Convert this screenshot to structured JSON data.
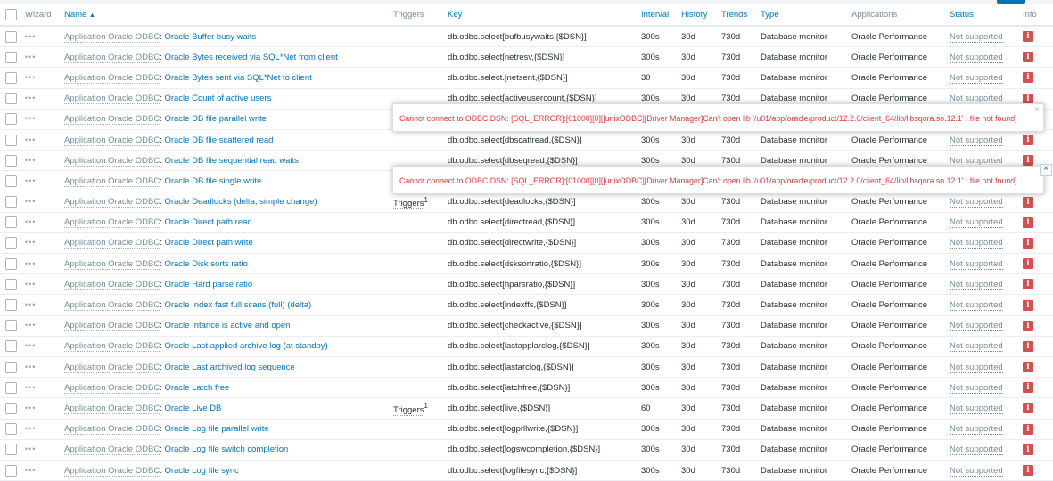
{
  "header": {
    "wizard": "Wizard",
    "name": "Name",
    "sort_indicator": "▲",
    "triggers": "Triggers",
    "key": "Key",
    "interval": "Interval",
    "history": "History",
    "trends": "Trends",
    "type": "Type",
    "applications": "Applications",
    "status": "Status",
    "info": "Info"
  },
  "rows": [
    {
      "prefix": "Application Oracle ODBC",
      "name": "Oracle Buffer busy waits",
      "triggers": "",
      "trig_count": "",
      "key": "db.odbc.select[bufbusywaits,{$DSN}]",
      "interval": "300s",
      "history": "30d",
      "trends": "730d",
      "type": "Database monitor",
      "app": "Oracle Performance",
      "status": "Not supported"
    },
    {
      "prefix": "Application Oracle ODBC",
      "name": "Oracle Bytes received via SQL*Net from client",
      "triggers": "",
      "trig_count": "",
      "key": "db.odbc.select[netresv,{$DSN}]",
      "interval": "300s",
      "history": "30d",
      "trends": "730d",
      "type": "Database monitor",
      "app": "Oracle Performance",
      "status": "Not supported"
    },
    {
      "prefix": "Application Oracle ODBC",
      "name": "Oracle Bytes sent via SQL*Net to client",
      "triggers": "",
      "trig_count": "",
      "key": "db.odbc.select.[netsent,{$DSN}]",
      "interval": "30",
      "history": "30d",
      "trends": "730d",
      "type": "Database monitor",
      "app": "Oracle Performance",
      "status": "Not supported"
    },
    {
      "prefix": "Application Oracle ODBC",
      "name": "Oracle Count of active users",
      "triggers": "",
      "trig_count": "",
      "key": "db.odbc.select[activeusercount,{$DSN}]",
      "interval": "300s",
      "history": "30d",
      "trends": "730d",
      "type": "Database monitor",
      "app": "Oracle Performance",
      "status": "Not supported"
    },
    {
      "prefix": "Application Oracle ODBC",
      "name": "Oracle DB file parallel write",
      "triggers": "",
      "trig_count": "",
      "key": "",
      "interval": "",
      "history": "",
      "trends": "",
      "type": "",
      "app": "",
      "status": ""
    },
    {
      "prefix": "Application Oracle ODBC",
      "name": "Oracle DB file scattered read",
      "triggers": "",
      "trig_count": "",
      "key": "db.odbc.select[dbscattread,{$DSN}]",
      "interval": "300s",
      "history": "30d",
      "trends": "730d",
      "type": "Database monitor",
      "app": "Oracle Performance",
      "status": "Not supported"
    },
    {
      "prefix": "Application Oracle ODBC",
      "name": "Oracle DB file sequential read waits",
      "triggers": "",
      "trig_count": "",
      "key": "db.odbc.select[dbseqread,{$DSN}]",
      "interval": "300s",
      "history": "30d",
      "trends": "730d",
      "type": "Database monitor",
      "app": "Oracle Performance",
      "status": "Not supported"
    },
    {
      "prefix": "Application Oracle ODBC",
      "name": "Oracle DB file single write",
      "triggers": "",
      "trig_count": "",
      "key": "",
      "interval": "",
      "history": "",
      "trends": "",
      "type": "",
      "app": "",
      "status": ""
    },
    {
      "prefix": "Application Oracle ODBC",
      "name": "Oracle Deadlocks (delta, simple change)",
      "triggers": "Triggers",
      "trig_count": "1",
      "key": "db.odbc.select[deadlocks,{$DSN}]",
      "interval": "300s",
      "history": "30d",
      "trends": "730d",
      "type": "Database monitor",
      "app": "Oracle Performance",
      "status": "Not supported"
    },
    {
      "prefix": "Application Oracle ODBC",
      "name": "Oracle Direct path read",
      "triggers": "",
      "trig_count": "",
      "key": "db.odbc.select[directread,{$DSN}]",
      "interval": "300s",
      "history": "30d",
      "trends": "730d",
      "type": "Database monitor",
      "app": "Oracle Performance",
      "status": "Not supported"
    },
    {
      "prefix": "Application Oracle ODBC",
      "name": "Oracle Direct path write",
      "triggers": "",
      "trig_count": "",
      "key": "db.odbc.select[directwrite,{$DSN}]",
      "interval": "300s",
      "history": "30d",
      "trends": "730d",
      "type": "Database monitor",
      "app": "Oracle Performance",
      "status": "Not supported"
    },
    {
      "prefix": "Application Oracle ODBC",
      "name": "Oracle Disk sorts ratio",
      "triggers": "",
      "trig_count": "",
      "key": "db.odbc.select[dsksortratio,{$DSN}]",
      "interval": "300s",
      "history": "30d",
      "trends": "730d",
      "type": "Database monitor",
      "app": "Oracle Performance",
      "status": "Not supported"
    },
    {
      "prefix": "Application Oracle ODBC",
      "name": "Oracle Hard parse ratio",
      "triggers": "",
      "trig_count": "",
      "key": "db.odbc.select[hparsratio,{$DSN}]",
      "interval": "300s",
      "history": "30d",
      "trends": "730d",
      "type": "Database monitor",
      "app": "Oracle Performance",
      "status": "Not supported"
    },
    {
      "prefix": "Application Oracle ODBC",
      "name": "Oracle Index fast full scans (full) (delta)",
      "triggers": "",
      "trig_count": "",
      "key": "db.odbc.select[indexffs,{$DSN}]",
      "interval": "300s",
      "history": "30d",
      "trends": "730d",
      "type": "Database monitor",
      "app": "Oracle Performance",
      "status": "Not supported"
    },
    {
      "prefix": "Application Oracle ODBC",
      "name": "Oracle Intance is active and open",
      "triggers": "",
      "trig_count": "",
      "key": "db.odbc.select[checkactive,{$DSN}]",
      "interval": "300s",
      "history": "30d",
      "trends": "730d",
      "type": "Database monitor",
      "app": "Oracle Performance",
      "status": "Not supported"
    },
    {
      "prefix": "Application Oracle ODBC",
      "name": "Oracle Last applied archive log (at standby)",
      "triggers": "",
      "trig_count": "",
      "key": "db.odbc.select[lastapplarclog,{$DSN}]",
      "interval": "300s",
      "history": "30d",
      "trends": "730d",
      "type": "Database monitor",
      "app": "Oracle Performance",
      "status": "Not supported"
    },
    {
      "prefix": "Application Oracle ODBC",
      "name": "Oracle Last archived log sequence",
      "triggers": "",
      "trig_count": "",
      "key": "db.odbc.select[lastarclog,{$DSN}]",
      "interval": "300s",
      "history": "30d",
      "trends": "730d",
      "type": "Database monitor",
      "app": "Oracle Performance",
      "status": "Not supported"
    },
    {
      "prefix": "Application Oracle ODBC",
      "name": "Oracle Latch free",
      "triggers": "",
      "trig_count": "",
      "key": "db.odbc.select[latchfree,{$DSN}]",
      "interval": "300s",
      "history": "30d",
      "trends": "730d",
      "type": "Database monitor",
      "app": "Oracle Performance",
      "status": "Not supported"
    },
    {
      "prefix": "Application Oracle ODBC",
      "name": "Oracle Live DB",
      "triggers": "Triggers",
      "trig_count": "1",
      "key": "db.odbc.select[live,{$DSN}]",
      "interval": "60",
      "history": "30d",
      "trends": "730d",
      "type": "Database monitor",
      "app": "Oracle Performance",
      "status": "Not supported"
    },
    {
      "prefix": "Application Oracle ODBC",
      "name": "Oracle Log file parallel write",
      "triggers": "",
      "trig_count": "",
      "key": "db.odbc.select[logprllwrite,{$DSN}]",
      "interval": "300s",
      "history": "30d",
      "trends": "730d",
      "type": "Database monitor",
      "app": "Oracle Performance",
      "status": "Not supported"
    },
    {
      "prefix": "Application Oracle ODBC",
      "name": "Oracle Log file switch completion",
      "triggers": "",
      "trig_count": "",
      "key": "db.odbc.select[logswcompletion,{$DSN}]",
      "interval": "300s",
      "history": "30d",
      "trends": "730d",
      "type": "Database monitor",
      "app": "Oracle Performance",
      "status": "Not supported"
    },
    {
      "prefix": "Application Oracle ODBC",
      "name": "Oracle Log file sync",
      "triggers": "",
      "trig_count": "",
      "key": "db.odbc.select[logfilesync,{$DSN}]",
      "interval": "300s",
      "history": "30d",
      "trends": "730d",
      "type": "Database monitor",
      "app": "Oracle Performance",
      "status": "Not supported"
    }
  ],
  "popups": [
    {
      "message": "Cannot connect to ODBC DSN: [SQL_ERROR]:[01000][0][[unixODBC][Driver Manager]Can't open lib '/u01/app/oracle/product/12.2.0/client_64/lib/libsqora.so.12.1' : file not found]",
      "close": "×"
    },
    {
      "message": "Cannot connect to ODBC DSN: [SQL_ERROR]:[01000][0][[unixODBC][Driver Manager]Can't open lib '/u01/app/oracle/product/12.2.0/client_64/lib/libsqora.so.12.1' : file not found]",
      "close": "×"
    }
  ],
  "info_glyph": "i",
  "wizard_glyph": "•••",
  "colors": {
    "link": "#0275b8",
    "error": "#dc3c3c",
    "info_bg": "#d64e4e"
  }
}
